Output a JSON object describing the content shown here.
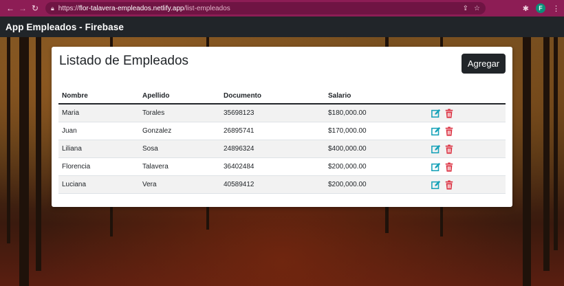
{
  "browser": {
    "url_scheme": "https://",
    "url_host": "flor-talavera-empleados.netlify.app",
    "url_path": "/list-empleados",
    "profile_initial": "F"
  },
  "navbar": {
    "brand": "App Empleados - Firebase"
  },
  "card": {
    "title": "Listado de Empleados",
    "add_label": "Agregar"
  },
  "table": {
    "headers": [
      "Nombre",
      "Apellido",
      "Documento",
      "Salario"
    ],
    "rows": [
      [
        "Maria",
        "Torales",
        "35698123",
        "$180,000.00"
      ],
      [
        "Juan",
        "Gonzalez",
        "26895741",
        "$170,000.00"
      ],
      [
        "Liliana",
        "Sosa",
        "24896324",
        "$400,000.00"
      ],
      [
        "Florencia",
        "Talavera",
        "36402484",
        "$200,000.00"
      ],
      [
        "Luciana",
        "Vera",
        "40589412",
        "$200,000.00"
      ]
    ]
  },
  "colors": {
    "chrome": "#8d1d55",
    "navbar": "#212529",
    "edit_icon": "#17a2b8",
    "delete_icon": "#dc3545"
  },
  "icons": {
    "edit": "edit-icon",
    "delete": "trash-icon"
  }
}
